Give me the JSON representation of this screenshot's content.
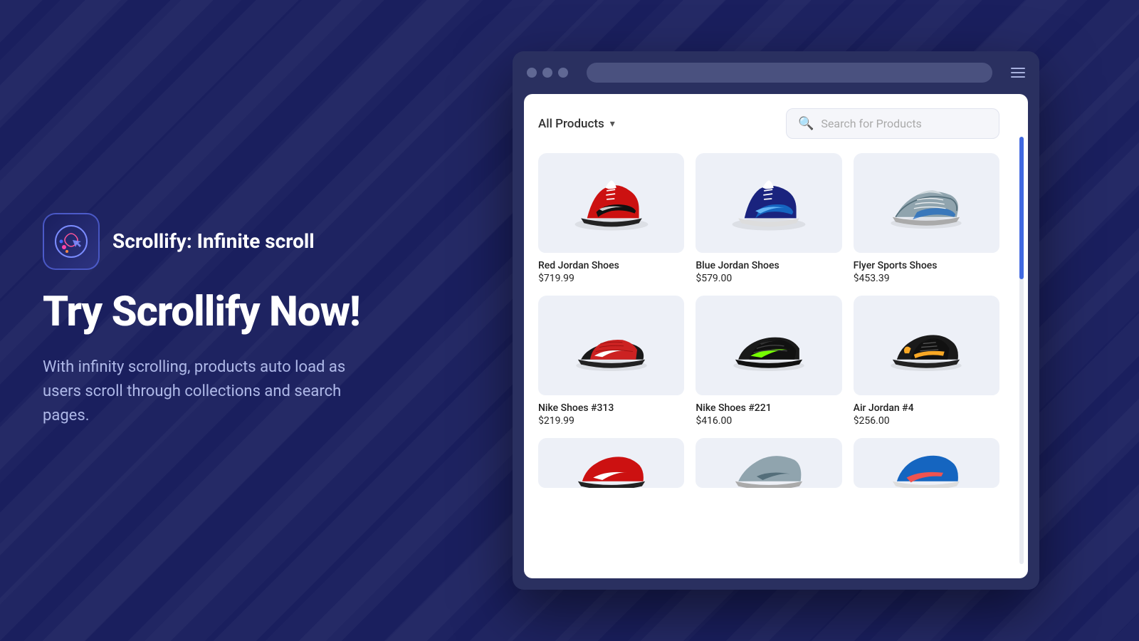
{
  "background": {
    "color": "#1a1f5e"
  },
  "left_panel": {
    "app": {
      "title": "Scrollify: Infinite scroll"
    },
    "hero": {
      "heading": "Try Scrollify Now!",
      "description": "With infinity scrolling, products auto load as users scroll through collections and search pages."
    }
  },
  "browser": {
    "toolbar": {
      "filter_label": "All Products",
      "filter_arrow": "▾",
      "search_placeholder": "Search for Products"
    },
    "menu_icon": "hamburger",
    "products": [
      {
        "name": "Red Jordan Shoes",
        "price": "$719.99",
        "color": "red",
        "id": "red-jordan"
      },
      {
        "name": "Blue Jordan Shoes",
        "price": "$579.00",
        "color": "blue",
        "id": "blue-jordan"
      },
      {
        "name": "Flyer Sports Shoes",
        "price": "$453.39",
        "color": "grey-blue",
        "id": "flyer-sports"
      },
      {
        "name": "Nike Shoes #313",
        "price": "$219.99",
        "color": "red-black",
        "id": "nike-313"
      },
      {
        "name": "Nike Shoes #221",
        "price": "$416.00",
        "color": "green-black",
        "id": "nike-221"
      },
      {
        "name": "Air Jordan #4",
        "price": "$256.00",
        "color": "black-yellow",
        "id": "air-jordan-4"
      }
    ],
    "partial_products": [
      {
        "id": "partial-1",
        "color": "red-black-2"
      },
      {
        "id": "partial-2",
        "color": "grey"
      },
      {
        "id": "partial-3",
        "color": "blue-red"
      }
    ]
  }
}
